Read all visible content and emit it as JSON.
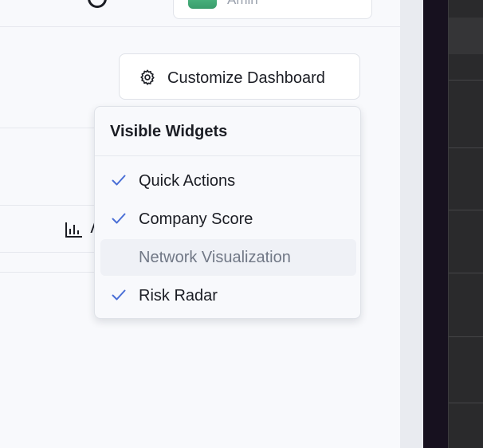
{
  "header": {
    "user_name": "Amin"
  },
  "toolbar": {
    "customize_label": "Customize Dashboard"
  },
  "dropdown": {
    "title": "Visible Widgets",
    "items": [
      {
        "label": "Quick Actions",
        "checked": true
      },
      {
        "label": "Company Score",
        "checked": true
      },
      {
        "label": "Network Visualization",
        "checked": false
      },
      {
        "label": "Risk Radar",
        "checked": true
      }
    ]
  },
  "colors": {
    "accent": "#3b5bdb",
    "check": "#4a6fd6",
    "avatar": "#4caf7d"
  }
}
